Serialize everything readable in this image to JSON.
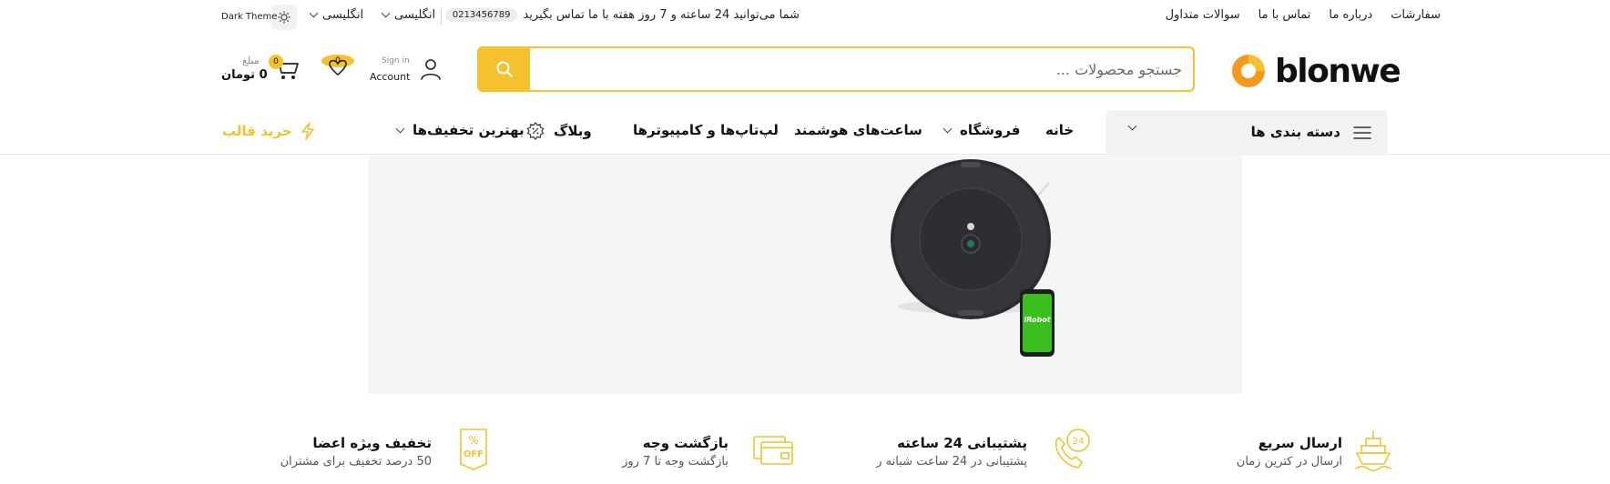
{
  "topbar": {
    "links": [
      "سفارشات",
      "درباره ما",
      "تماس با ما",
      "سوالات متداول"
    ],
    "announcement": "شما می‌توانید 24 ساعته و 7 روز هفته با ما تماس بگیرید",
    "phone": "0213456789",
    "language_1": "انگلیسی",
    "language_2": "انگلیسی",
    "theme_label": "Dark Theme"
  },
  "header": {
    "logo_text": "blonwe",
    "search_placeholder": "جستجو محصولات ...",
    "account_signin": "Sign in",
    "account_label": "Account",
    "wishlist_count": "0",
    "cart_count": "0",
    "cart_amount_label": "مبلغ",
    "cart_amount": "0 تومان"
  },
  "nav": {
    "categories_label": "دسته بندی ها",
    "items": [
      "خانه",
      "فروشگاه",
      "ساعت‌های هوشمند",
      "لپ‌تاپ‌ها و کامپیوترها",
      "وبلاگ",
      "بهترین تخفیف‌ها"
    ],
    "buy_theme": "خرید قالب"
  },
  "banner": {
    "phone_brand_text": "iRobot"
  },
  "features": [
    {
      "title": "ارسال سریع",
      "subtitle": "ارسال در کترین زمان",
      "icon": "ship-icon"
    },
    {
      "title": "پشتیبانی 24 ساعته",
      "subtitle": "پشتیبانی در 24 ساعت شبانه ر",
      "icon": "phone-24-icon"
    },
    {
      "title": "بازگشت وجه",
      "subtitle": "بازگشت وجه تا 7 روز",
      "icon": "card-icon"
    },
    {
      "title": "تخفیف ویژه اعضا",
      "subtitle": "50 درصد تخفیف برای مشتران",
      "icon": "discount-badge-icon"
    }
  ],
  "colors": {
    "accent": "#f5c12e",
    "logo_orange": "#f39a1e",
    "nav_bg": "#f2f2f2",
    "banner_bg": "#f5f5f5"
  }
}
